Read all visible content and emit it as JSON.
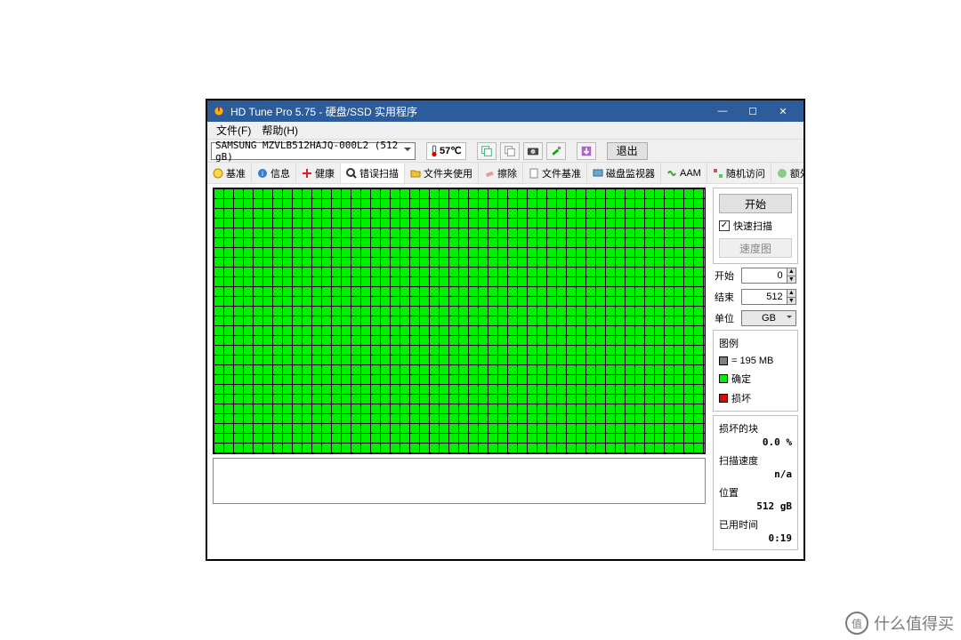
{
  "title": "HD Tune Pro 5.75 - 硬盘/SSD 实用程序",
  "menu": {
    "file": "文件(F)",
    "help": "帮助(H)"
  },
  "drive": "SAMSUNG MZVLB512HAJQ-000L2 (512 gB)",
  "temp": "57℃",
  "exit": "退出",
  "tabs": [
    "基准",
    "信息",
    "健康",
    "错误扫描",
    "文件夹使用",
    "擦除",
    "文件基准",
    "磁盘监视器",
    "AAM",
    "随机访问",
    "额外测试"
  ],
  "right": {
    "start": "开始",
    "quick_label": "快速扫描",
    "speedmap": "速度图",
    "start_label": "开始",
    "start_val": "0",
    "end_label": "结束",
    "end_val": "512",
    "unit_label": "单位",
    "unit_val": "GB",
    "legend_title": "图例",
    "legend_block": "= 195 MB",
    "legend_ok": "确定",
    "legend_bad": "损坏",
    "stat_damaged": "损坏的块",
    "stat_damaged_v": "0.0 %",
    "stat_speed": "扫描速度",
    "stat_speed_v": "n/a",
    "stat_pos": "位置",
    "stat_pos_v": "512 gB",
    "stat_time": "已用时间",
    "stat_time_v": "0:19"
  },
  "watermark": "什么值得买"
}
